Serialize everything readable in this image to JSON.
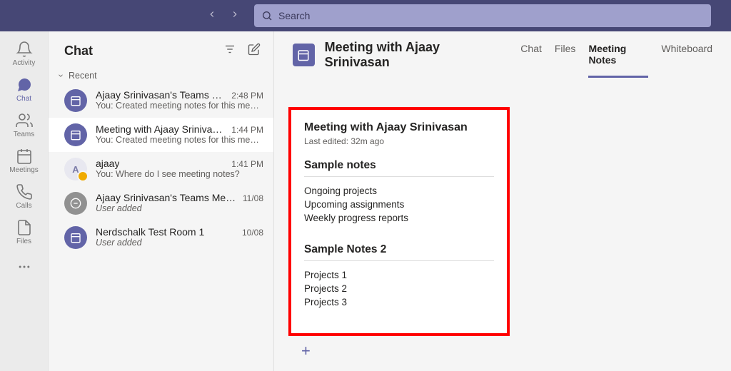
{
  "search": {
    "placeholder": "Search"
  },
  "rail": {
    "activity": "Activity",
    "chat": "Chat",
    "teams": "Teams",
    "meetings": "Meetings",
    "calls": "Calls",
    "files": "Files"
  },
  "chatPanel": {
    "title": "Chat",
    "section": "Recent",
    "items": [
      {
        "title": "Ajaay Srinivasan's Teams Mee…",
        "time": "2:48 PM",
        "preview": "You: Created meeting notes for this me…",
        "avatar": "purple"
      },
      {
        "title": "Meeting with Ajaay Srinivasan",
        "time": "1:44 PM",
        "preview": "You: Created meeting notes for this me…",
        "avatar": "purple",
        "selected": true
      },
      {
        "title": "ajaay",
        "time": "1:41 PM",
        "preview": "You: Where do I see meeting notes?",
        "avatar": "letter",
        "letter": "A"
      },
      {
        "title": "Ajaay Srinivasan's Teams Meeting",
        "time": "11/08",
        "preview": "User added",
        "avatar": "grey",
        "italic": true
      },
      {
        "title": "Nerdschalk Test Room 1",
        "time": "10/08",
        "preview": "User added",
        "avatar": "purple",
        "italic": true
      }
    ]
  },
  "main": {
    "title": "Meeting with Ajaay Srinivasan",
    "tabs": [
      "Chat",
      "Files",
      "Meeting Notes",
      "Whiteboard"
    ],
    "activeTab": 2,
    "notes": {
      "title": "Meeting with Ajaay Srinivasan",
      "edited": "Last edited: 32m ago",
      "sections": [
        {
          "heading": "Sample notes",
          "lines": [
            "Ongoing projects",
            "Upcoming assignments",
            "Weekly progress reports"
          ]
        },
        {
          "heading": "Sample Notes 2",
          "lines": [
            "Projects 1",
            "Projects 2",
            "Projects 3"
          ]
        }
      ]
    }
  }
}
